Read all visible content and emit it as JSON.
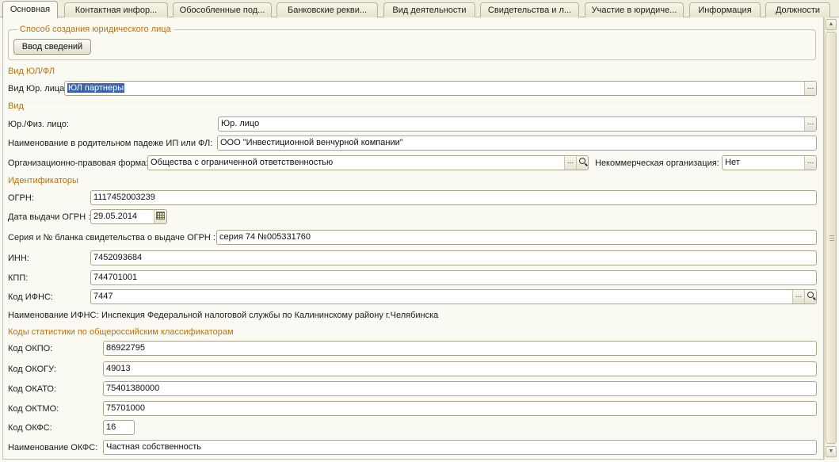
{
  "tabs": [
    {
      "label": "Основная",
      "active": true
    },
    {
      "label": "Контактная инфор...",
      "active": false
    },
    {
      "label": "Обособленные под...",
      "active": false
    },
    {
      "label": "Банковские рекви...",
      "active": false
    },
    {
      "label": "Вид деятельности",
      "active": false
    },
    {
      "label": "Свидетельства и л...",
      "active": false
    },
    {
      "label": "Участие в юридиче...",
      "active": false
    },
    {
      "label": "Информация",
      "active": false
    },
    {
      "label": "Должности",
      "active": false
    }
  ],
  "creation_group": {
    "title": "Способ создания юридического лица",
    "button_label": "Ввод сведений"
  },
  "entity_kind": {
    "section_title": "Вид ЮЛ/ФЛ",
    "label": "Вид Юр. лица:",
    "value": "ЮЛ партнеры",
    "choose_btn": "..."
  },
  "kind": {
    "section_title": "Вид",
    "legal_physical_label": "Юр./Физ. лицо:",
    "legal_physical_value": "Юр. лицо",
    "genitive_label": "Наименование в родительном падеже ИП или ФЛ:",
    "genitive_value": "ООО \"Инвестиционной венчурной компании\"",
    "org_form_label": "Организационно-правовая форма:",
    "org_form_value": "Общества с ограниченной ответственностью",
    "noncommercial_label": "Некоммерческая организация:",
    "noncommercial_value": "Нет"
  },
  "identifiers": {
    "section_title": "Идентификаторы",
    "ogrn_label": "ОГРН:",
    "ogrn_value": "1117452003239",
    "ogrn_date_label": "Дата выдачи ОГРН :",
    "ogrn_date_value": "29.05.2014",
    "cert_label": "Серия и № бланка свидетельства о выдаче ОГРН :",
    "cert_value": "серия 74 №005331760",
    "inn_label": "ИНН:",
    "inn_value": "7452093684",
    "kpp_label": "КПП:",
    "kpp_value": "744701001",
    "ifns_label": "Код ИФНС:",
    "ifns_value": "7447",
    "ifns_name_label": "Наименование ИФНС:",
    "ifns_name_value": "Инспекция Федеральной налоговой службы по Калининскому району г.Челябинска"
  },
  "stat_codes": {
    "section_title": "Коды статистики по общероссийским классификаторам",
    "okpo_label": "Код ОКПО:",
    "okpo_value": "86922795",
    "okogu_label": "Код ОКОГУ:",
    "okogu_value": "49013",
    "okato_label": "Код ОКАТО:",
    "okato_value": "75401380000",
    "oktmo_label": "Код ОКТМО:",
    "oktmo_value": "75701000",
    "okfs_label": "Код ОКФС:",
    "okfs_value": "16",
    "okfs_name_label": "Наименование ОКФС:",
    "okfs_name_value": "Частная собственность"
  },
  "icons": {
    "choose": "ellipsis-icon",
    "search": "magnifier-icon",
    "calendar": "calendar-icon",
    "scroll_up": "arrow-up-icon",
    "scroll_down": "arrow-down-icon"
  },
  "colors": {
    "section_title": "#b5720e",
    "selection": "#3a63b4",
    "background": "#fbfaf2"
  }
}
